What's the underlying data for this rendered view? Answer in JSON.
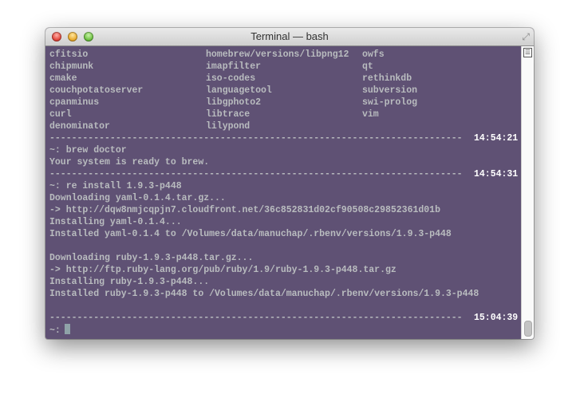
{
  "window": {
    "title": "Terminal — bash"
  },
  "columns_listing": [
    [
      "cfitsio",
      "homebrew/versions/libpng12",
      "owfs"
    ],
    [
      "chipmunk",
      "imapfilter",
      "qt"
    ],
    [
      "cmake",
      "iso-codes",
      "rethinkdb"
    ],
    [
      "couchpotatoserver",
      "languagetool",
      "subversion"
    ],
    [
      "cpanminus",
      "libgphoto2",
      "swi-prolog"
    ],
    [
      "curl",
      "libtrace",
      "vim"
    ],
    [
      "denominator",
      "lilypond",
      ""
    ]
  ],
  "separator": "---------------------------------------------------------------------------",
  "lines": [
    {
      "sep": true,
      "time": "14:54:21"
    },
    {
      "text": "~: brew doctor"
    },
    {
      "text": "Your system is ready to brew."
    },
    {
      "sep": true,
      "time": "14:54:31"
    },
    {
      "text": "~: re install 1.9.3-p448"
    },
    {
      "text": "Downloading yaml-0.1.4.tar.gz..."
    },
    {
      "text": "-> http://dqw8nmjcqpjn7.cloudfront.net/36c852831d02cf90508c29852361d01b"
    },
    {
      "text": "Installing yaml-0.1.4..."
    },
    {
      "text": "Installed yaml-0.1.4 to /Volumes/data/manuchap/.rbenv/versions/1.9.3-p448"
    },
    {
      "text": ""
    },
    {
      "text": "Downloading ruby-1.9.3-p448.tar.gz..."
    },
    {
      "text": "-> http://ftp.ruby-lang.org/pub/ruby/1.9/ruby-1.9.3-p448.tar.gz"
    },
    {
      "text": "Installing ruby-1.9.3-p448..."
    },
    {
      "text": "Installed ruby-1.9.3-p448 to /Volumes/data/manuchap/.rbenv/versions/1.9.3-p448"
    },
    {
      "text": ""
    },
    {
      "sep": true,
      "time": "15:04:39"
    }
  ],
  "prompt": "~:",
  "colors": {
    "background": "#5f5174",
    "text": "#b9bcbf",
    "timestamp": "#ffffff"
  }
}
